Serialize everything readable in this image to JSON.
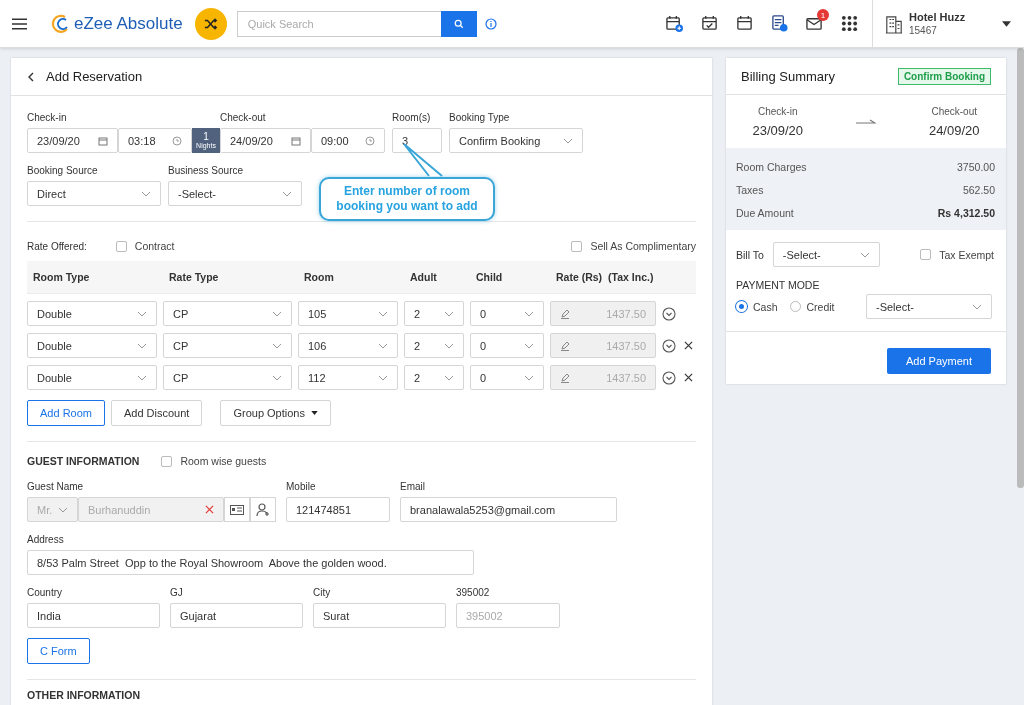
{
  "header": {
    "brand": "eZee Absolute",
    "search": {
      "placeholder": "Quick Search"
    },
    "tools": [
      {
        "kind": "calendar-plus"
      },
      {
        "kind": "calendar-check"
      },
      {
        "kind": "calendar"
      },
      {
        "kind": "invoice"
      },
      {
        "kind": "mail",
        "badge": "1"
      },
      {
        "kind": "apps"
      }
    ],
    "hotel": {
      "name": "Hotel Huzz",
      "code": "15467"
    }
  },
  "reservation": {
    "title": "Add Reservation",
    "stay": {
      "checkin_label": "Check-in",
      "checkin_date": "23/09/20",
      "checkin_time": "03:18",
      "nights": "1",
      "nights_label": "Nights",
      "checkout_label": "Check-out",
      "checkout_date": "24/09/20",
      "checkout_time": "09:00",
      "rooms_label": "Room(s)",
      "rooms": "3",
      "booking_type_label": "Booking Type",
      "booking_type": "Confirm Booking"
    },
    "sources": [
      {
        "label": "Booking Source",
        "value": "Direct"
      },
      {
        "label": "Business Source",
        "value": "-Select-"
      }
    ],
    "tooltip": "Enter number of room booking you want to add",
    "rate_offered_label": "Rate Offered:",
    "options": [
      {
        "label": "Contract",
        "checked": false
      },
      {
        "label": "Sell As Complimentary",
        "checked": false
      }
    ],
    "room_columns": [
      "Room Type",
      "Rate Type",
      "Room",
      "Adult",
      "Child",
      "Rate (Rs)",
      "(Tax Inc.)"
    ],
    "rooms": [
      {
        "room_type": "Double",
        "rate_type": "CP",
        "room": "105",
        "adult": "2",
        "child": "0",
        "rate": "1437.50",
        "removable": false
      },
      {
        "room_type": "Double",
        "rate_type": "CP",
        "room": "106",
        "adult": "2",
        "child": "0",
        "rate": "1437.50",
        "removable": true
      },
      {
        "room_type": "Double",
        "rate_type": "CP",
        "room": "112",
        "adult": "2",
        "child": "0",
        "rate": "1437.50",
        "removable": true
      }
    ],
    "room_buttons": [
      {
        "label": "Add Room",
        "kind": "primary"
      },
      {
        "label": "Add Discount",
        "kind": "plain"
      },
      {
        "label": "Group Options",
        "kind": "menu"
      }
    ],
    "guest": {
      "title": "GUEST INFORMATION",
      "room_wise": {
        "label": "Room wise guests",
        "checked": false
      },
      "name_label": "Guest Name",
      "salutation": "Mr.",
      "name": "Burhanuddin",
      "mobile_label": "Mobile",
      "mobile": "121474851",
      "email_label": "Email",
      "email": "branalawala5253@gmail.com",
      "address_label": "Address",
      "address": "8/53 Palm Street  Opp to the Royal Showroom  Above the golden wood.",
      "location": [
        {
          "label": "Country",
          "value": "India"
        },
        {
          "label": "GJ",
          "value": "Gujarat"
        },
        {
          "label": "City",
          "value": "Surat"
        },
        {
          "label": "395002",
          "placeholder": "395002"
        }
      ],
      "c_form": "C Form"
    },
    "next_section": "OTHER INFORMATION"
  },
  "billing": {
    "title": "Billing Summary",
    "status": "Confirm Booking",
    "checkin_label": "Check-in",
    "checkin": "23/09/20",
    "checkout_label": "Check-out",
    "checkout": "24/09/20",
    "charges": [
      {
        "label": "Room Charges",
        "value": "3750.00",
        "kind": "line"
      },
      {
        "label": "Taxes",
        "value": "562.50",
        "kind": "line"
      },
      {
        "label": "Due Amount",
        "value": "Rs 4,312.50",
        "kind": "total"
      }
    ],
    "bill_to_label": "Bill To",
    "bill_to": "-Select-",
    "tax_exempt": {
      "label": "Tax Exempt",
      "checked": false
    },
    "payment_mode_title": "PAYMENT MODE",
    "modes": [
      {
        "label": "Cash",
        "selected": true
      },
      {
        "label": "Credit",
        "selected": false
      }
    ],
    "mode_select": "-Select-",
    "action": "Add Payment"
  }
}
